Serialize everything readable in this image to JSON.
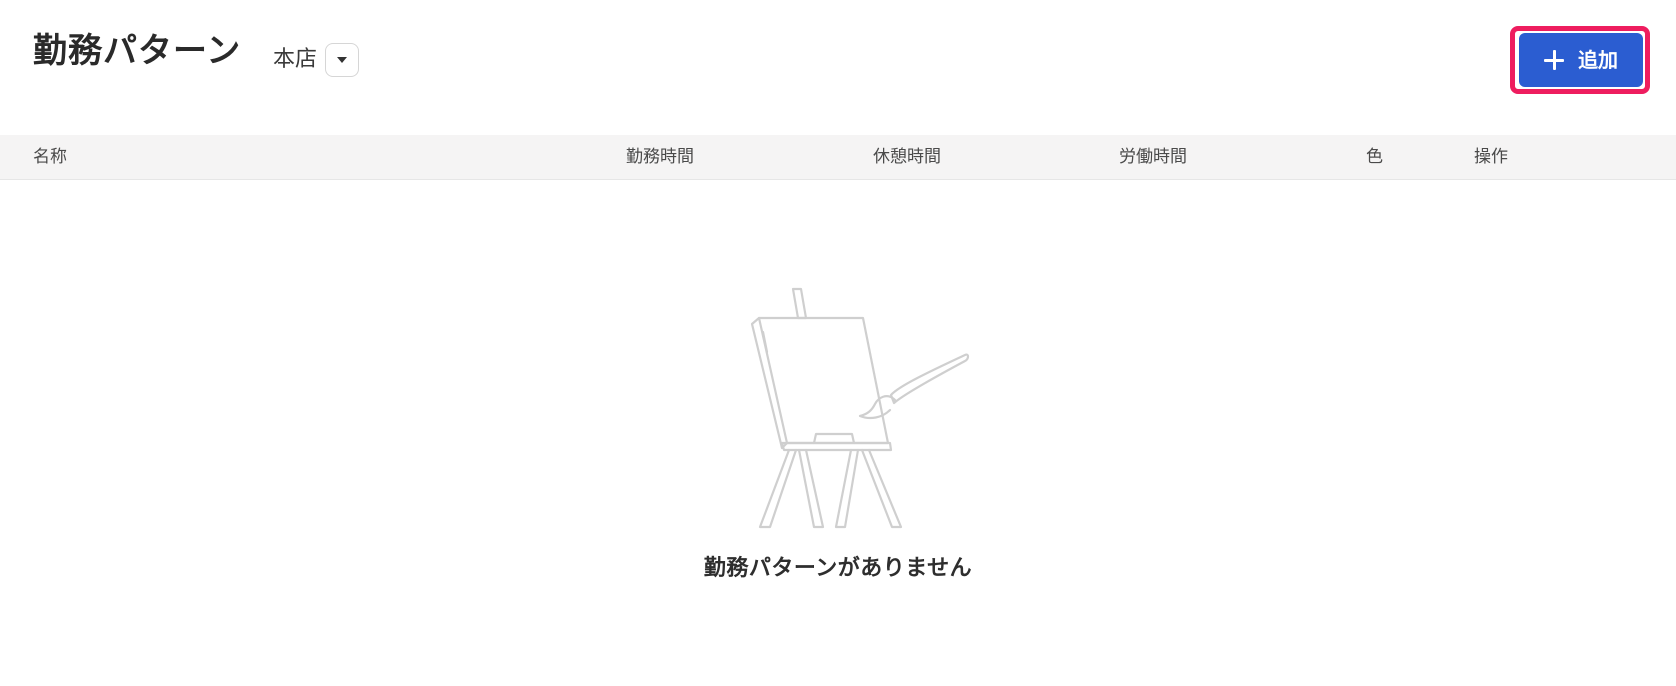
{
  "header": {
    "title": "勤務パターン",
    "store": "本店",
    "add_label": "追加",
    "accent_color": "#2b5dd1",
    "highlight_color": "#ee1d5f"
  },
  "table": {
    "columns": [
      "名称",
      "勤務時間",
      "休憩時間",
      "労働時間",
      "色",
      "操作"
    ]
  },
  "empty_state": {
    "icon": "easel-icon",
    "message": "勤務パターンがありません"
  }
}
